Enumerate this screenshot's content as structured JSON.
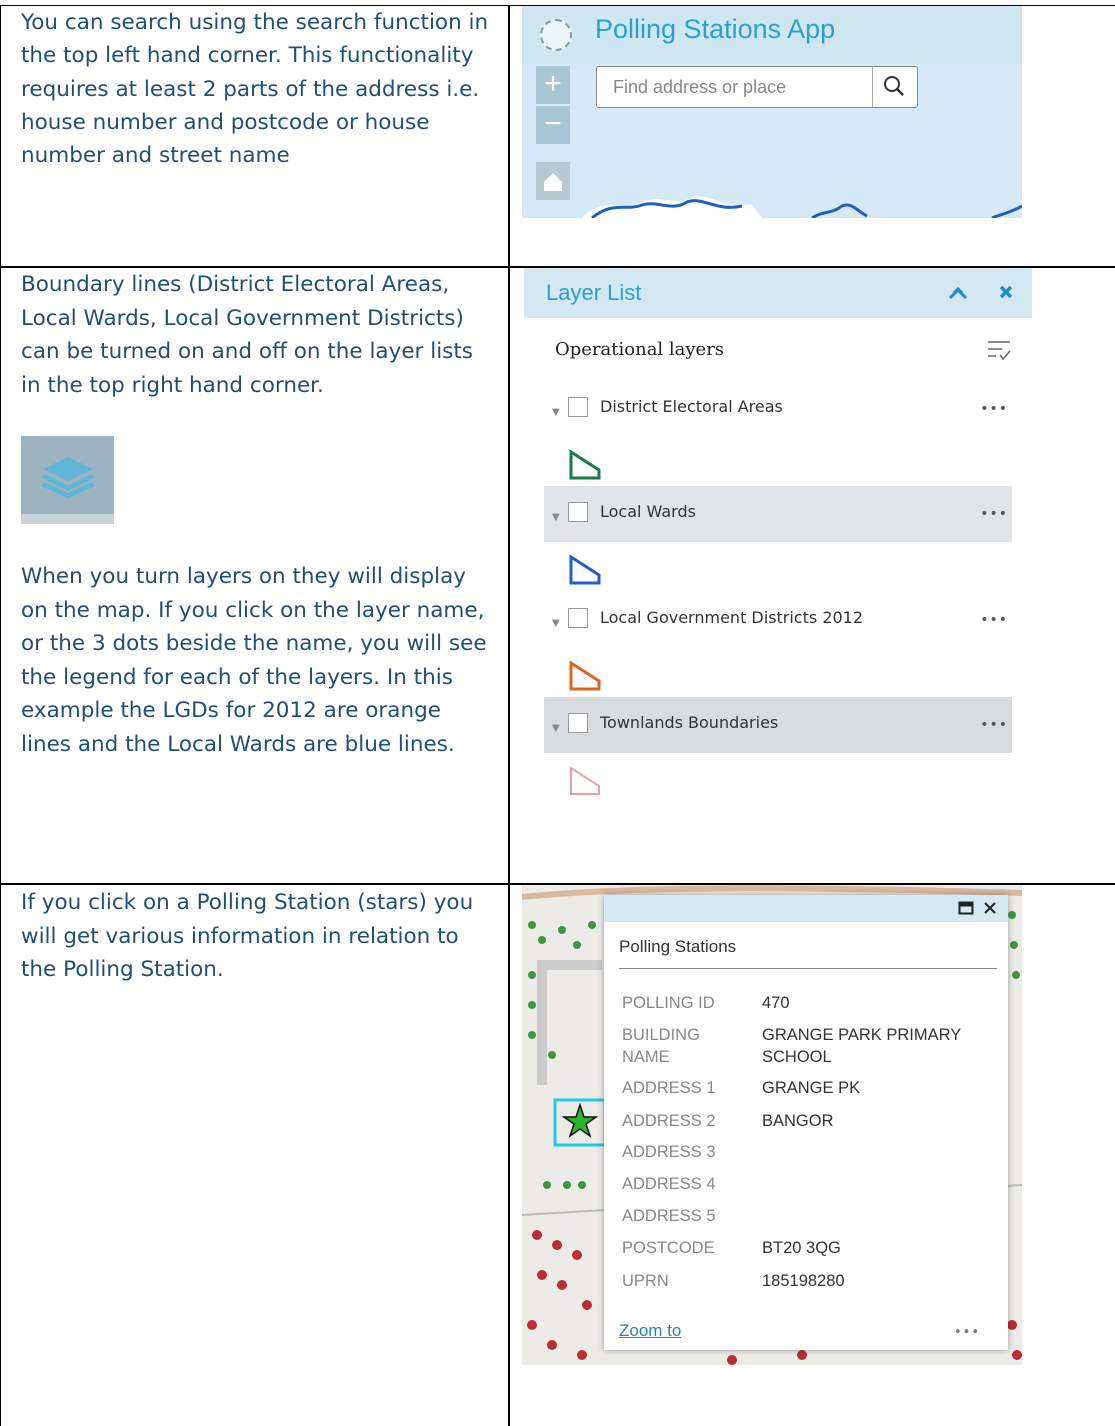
{
  "rows": [
    {
      "text": "You can search using the search function in the top left hand corner. This functionality requires at least 2 parts of the address i.e. house number and postcode or house number and street name"
    },
    {
      "text_a": "Boundary lines (District Electoral Areas, Local Wards, Local Government Districts) can be turned on and off on the layer lists in the top right hand corner.",
      "text_b": "When you turn layers on they will display on the map. If you click on the layer name, or the 3 dots beside the name, you will see the legend for each of the layers. In this example the LGDs for 2012 are orange lines and the Local Wards are blue lines.",
      "layers_icon": "stacked-layers-icon"
    },
    {
      "text": "If you click on a Polling Station (stars) you will get various information in relation to the Polling Station."
    }
  ],
  "app": {
    "title": "Polling Stations App",
    "search_placeholder": "Find address or place",
    "zoom_in": "+",
    "zoom_out": "−"
  },
  "layer_list": {
    "title": "Layer List",
    "section": "Operational layers",
    "more": "•••",
    "layers": [
      {
        "label": "District Electoral Areas",
        "color": "#1a7a4c"
      },
      {
        "label": "Local Wards",
        "color": "#1f5fd1"
      },
      {
        "label": "Local Government Districts 2012",
        "color": "#e0641e"
      },
      {
        "label": "Townlands Boundaries",
        "color": "#e9a0a0"
      }
    ]
  },
  "popup": {
    "title": "Polling Stations",
    "fields": [
      {
        "key": "POLLING ID",
        "value": "470"
      },
      {
        "key": "BUILDING NAME",
        "value": "GRANGE PARK PRIMARY SCHOOL"
      },
      {
        "key": "ADDRESS 1",
        "value": "GRANGE PK"
      },
      {
        "key": "ADDRESS 2",
        "value": "BANGOR"
      },
      {
        "key": "ADDRESS 3",
        "value": ""
      },
      {
        "key": "ADDRESS 4",
        "value": ""
      },
      {
        "key": "ADDRESS 5",
        "value": ""
      },
      {
        "key": "POSTCODE",
        "value": "BT20 3QG"
      },
      {
        "key": "UPRN",
        "value": "185198280"
      }
    ],
    "zoom_label": "Zoom to",
    "more": "•••"
  },
  "colors": {
    "doc_text": "#1f4e79",
    "accent": "#2a9fd6",
    "station_star": "#2bb52b"
  }
}
